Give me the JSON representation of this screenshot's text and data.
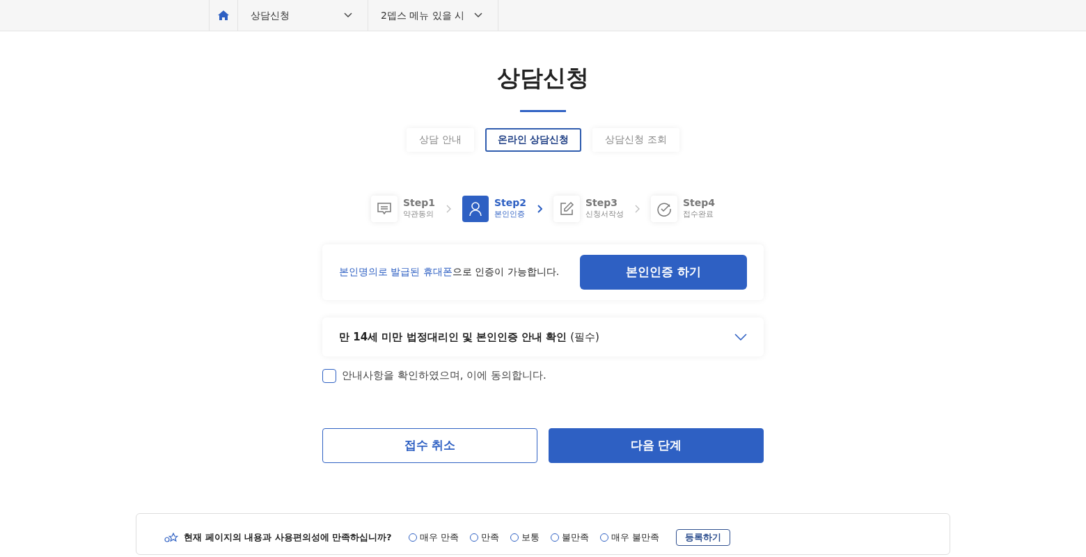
{
  "breadcrumb": {
    "menus": [
      {
        "label": "상담신청"
      },
      {
        "label": "2뎁스 메뉴 있을 시"
      }
    ]
  },
  "title": "상담신청",
  "tabs": [
    {
      "label": "상담 안내",
      "selected": false
    },
    {
      "label": "온라인 상담신청",
      "selected": true
    },
    {
      "label": "상담신청 조회",
      "selected": false
    }
  ],
  "steps": [
    {
      "kind": "chat",
      "label": "Step1",
      "sub": "약관동의",
      "selected": false
    },
    {
      "kind": "person",
      "label": "Step2",
      "sub": "본인인증",
      "selected": true
    },
    {
      "kind": "edit",
      "label": "Step3",
      "sub": "신청서작성",
      "selected": false
    },
    {
      "kind": "check",
      "label": "Step4",
      "sub": "접수완료",
      "selected": false
    }
  ],
  "auth": {
    "highlight": "본인명의로 발급된 휴대폰",
    "text": "으로 인증이 가능합니다.",
    "button": "본인인증 하기"
  },
  "accordion": {
    "title": "만 14세 미만 법정대리인 및 본인인증 안내 확인",
    "note": "(필수)",
    "expanded": false
  },
  "agree": {
    "label": "안내사항을 확인하였으며, 이에 동의합니다.",
    "checked": false
  },
  "buttons": [
    {
      "label": "접수 취소",
      "kind": "outline"
    },
    {
      "label": "다음 단계",
      "kind": "primary"
    }
  ],
  "feedback": {
    "question": "현재 페이지의 내용과 사용편의성에 만족하십니까?",
    "options": [
      {
        "label": "매우 만족",
        "selected": false
      },
      {
        "label": "만족",
        "selected": false
      },
      {
        "label": "보통",
        "selected": false
      },
      {
        "label": "불만족",
        "selected": false
      },
      {
        "label": "매우 불만족",
        "selected": false
      }
    ],
    "submit": "등록하기"
  }
}
